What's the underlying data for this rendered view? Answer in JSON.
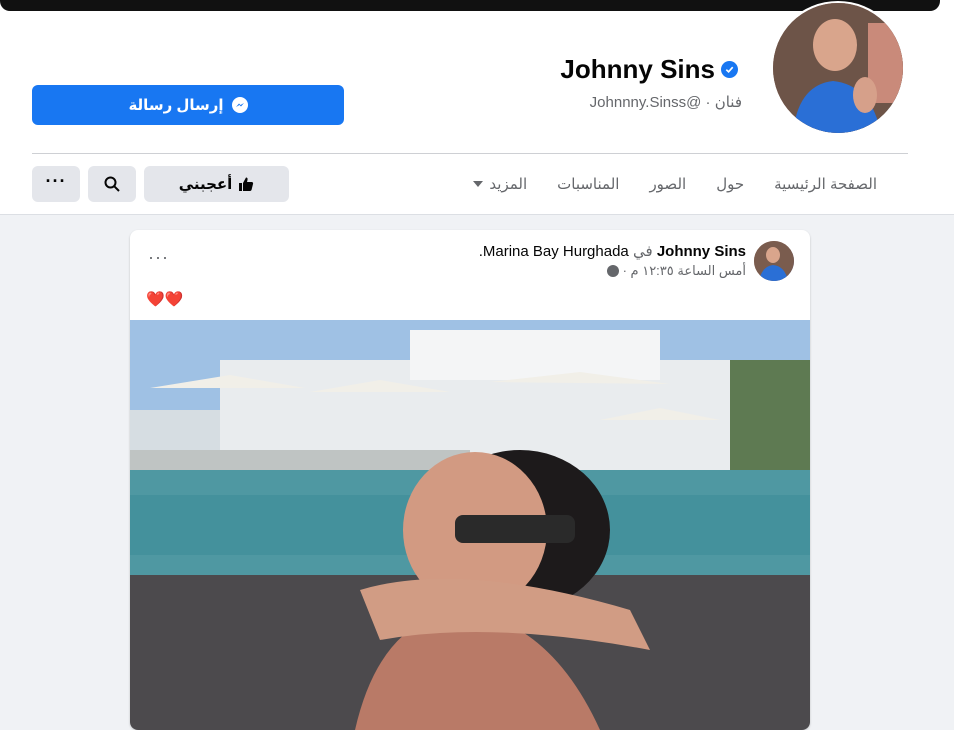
{
  "profile": {
    "name": "Johnny Sins",
    "category": "فنان",
    "username": "@Johnnny.Sinss",
    "send_message_label": "إرسال رسالة"
  },
  "nav": {
    "tabs": [
      "الصفحة الرئيسية",
      "حول",
      "الصور",
      "المناسبات",
      "المزيد"
    ],
    "like_label": "أعجبني"
  },
  "post": {
    "author": "Johnny Sins",
    "connector": "في",
    "location": "Marina Bay Hurghada.",
    "time": "أمس الساعة ١٢:٣٥ م ·",
    "text": "❤️❤️"
  },
  "colors": {
    "accent": "#1877f2",
    "page_bg": "#f0f2f5",
    "button_gray": "#e4e6eb"
  }
}
